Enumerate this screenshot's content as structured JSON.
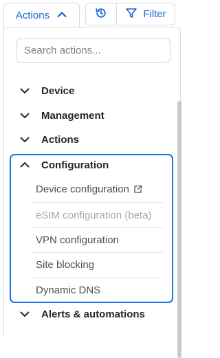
{
  "toolbar": {
    "actions_label": "Actions",
    "filter_label": "Filter"
  },
  "search": {
    "placeholder": "Search actions..."
  },
  "groups": [
    {
      "label": "Device",
      "expanded": false
    },
    {
      "label": "Management",
      "expanded": false
    },
    {
      "label": "Actions",
      "expanded": false
    },
    {
      "label": "Configuration",
      "expanded": true
    },
    {
      "label": "Alerts & automations",
      "expanded": false
    }
  ],
  "configuration_items": [
    {
      "label": "Device configuration",
      "external": true,
      "disabled": false
    },
    {
      "label": "eSIM configuration (beta)",
      "external": false,
      "disabled": true
    },
    {
      "label": "VPN configuration",
      "external": false,
      "disabled": false
    },
    {
      "label": "Site blocking",
      "external": false,
      "disabled": false
    },
    {
      "label": "Dynamic DNS",
      "external": false,
      "disabled": false
    }
  ],
  "colors": {
    "accent": "#1565d8",
    "focus_border": "#1a73e8"
  }
}
